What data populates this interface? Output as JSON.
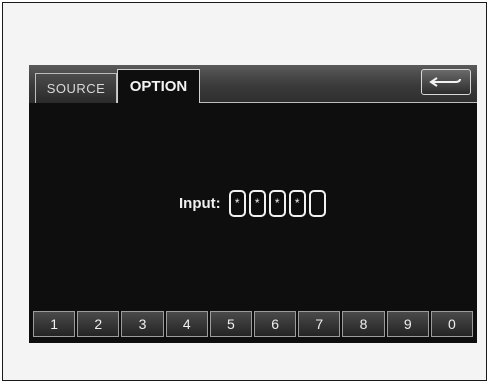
{
  "tabs": [
    {
      "label": "SOURCE",
      "active": false
    },
    {
      "label": "OPTION",
      "active": true
    }
  ],
  "back_button": {
    "icon": "back-arrow-icon"
  },
  "input": {
    "label": "Input:",
    "digits": [
      "*",
      "*",
      "*",
      "*",
      ""
    ]
  },
  "keypad": {
    "keys": [
      "1",
      "2",
      "3",
      "4",
      "5",
      "6",
      "7",
      "8",
      "9",
      "0"
    ]
  },
  "colors": {
    "screen_background": "#0e0e0e",
    "text": "#f0f0f0",
    "border": "#bdbdbd"
  }
}
